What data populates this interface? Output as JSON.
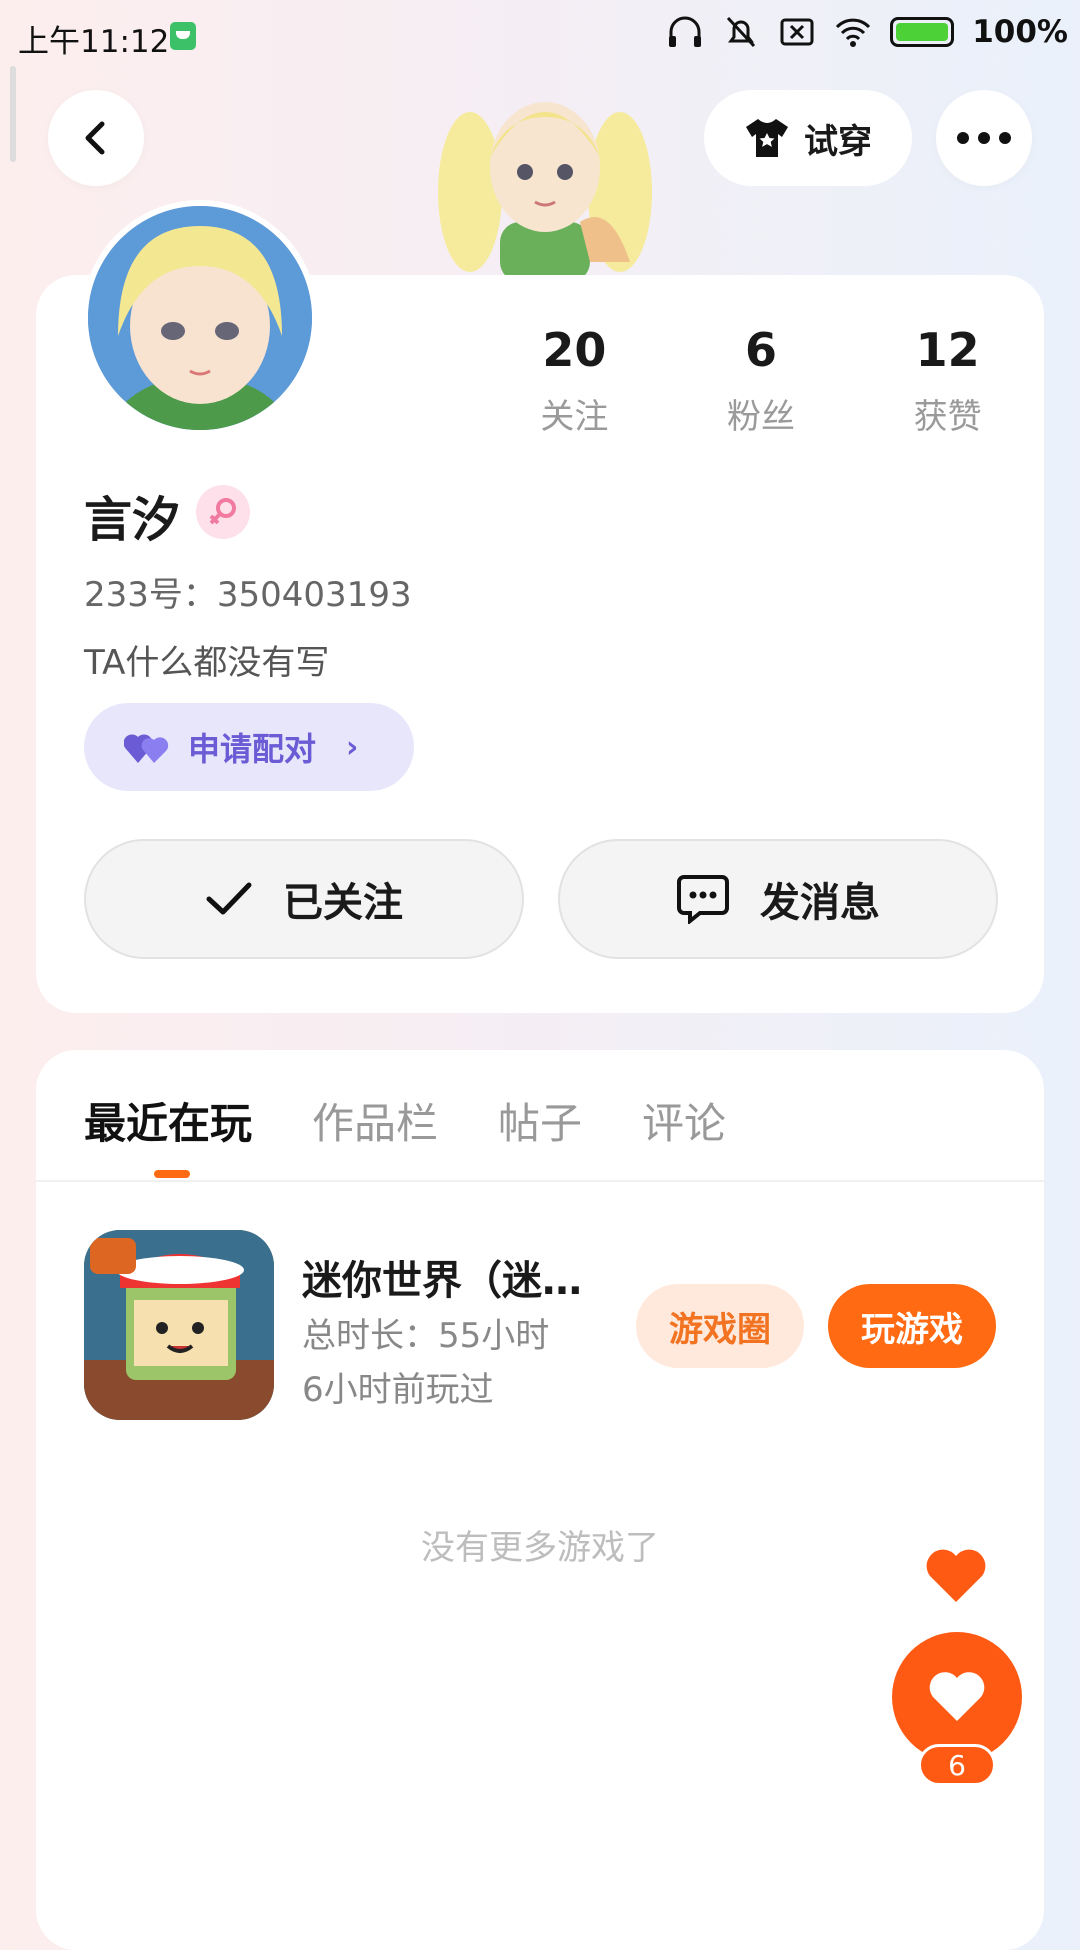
{
  "status_bar": {
    "time": "上午11:12",
    "battery": "100%"
  },
  "top_bar": {
    "try_on_label": "试穿"
  },
  "profile": {
    "stats": [
      {
        "value": "20",
        "label": "关注"
      },
      {
        "value": "6",
        "label": "粉丝"
      },
      {
        "value": "12",
        "label": "获赞"
      }
    ],
    "name": "言汐",
    "uid": "233号：350403193",
    "bio": "TA什么都没有写",
    "pair_label": "申请配对",
    "follow_label": "已关注",
    "message_label": "发消息"
  },
  "tabs": [
    {
      "label": "最近在玩",
      "active": true
    },
    {
      "label": "作品栏",
      "active": false
    },
    {
      "label": "帖子",
      "active": false
    },
    {
      "label": "评论",
      "active": false
    }
  ],
  "games": [
    {
      "title": "迷你世界（迷…",
      "duration": "总时长：55小时",
      "last_played": "6小时前玩过",
      "circle_label": "游戏圈",
      "play_label": "玩游戏"
    }
  ],
  "no_more_text": "没有更多游戏了",
  "like_count": "6",
  "colors": {
    "accent": "#ff6a13",
    "like": "#ff5a14",
    "pair": "#6b5bd4"
  }
}
